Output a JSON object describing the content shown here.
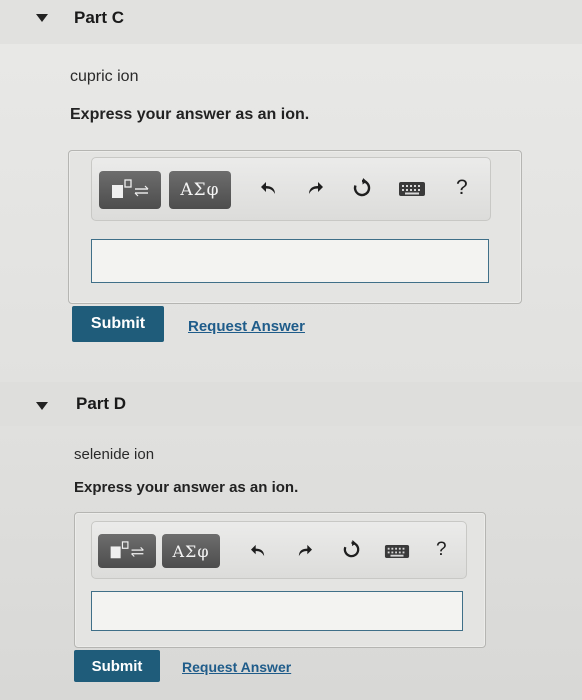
{
  "partC": {
    "title": "Part C",
    "prompt": "cupric ion",
    "instruction": "Express your answer as an ion.",
    "toolbar": {
      "greek_label": "ΑΣφ",
      "help_label": "?"
    },
    "input_value": "",
    "submit_label": "Submit",
    "request_label": "Request Answer"
  },
  "partD": {
    "title": "Part D",
    "prompt": "selenide ion",
    "instruction": "Express your answer as an ion.",
    "toolbar": {
      "greek_label": "ΑΣφ",
      "help_label": "?"
    },
    "input_value": "",
    "submit_label": "Submit",
    "request_label": "Request Answer"
  },
  "icons": [
    "collapse-caret-icon",
    "templates-icon",
    "undo-icon",
    "redo-icon",
    "reset-icon",
    "keyboard-icon",
    "help-icon"
  ],
  "colors": {
    "submit_bg": "#1f5c7a",
    "link": "#1f5c8a",
    "input_border": "#3f6f88"
  }
}
